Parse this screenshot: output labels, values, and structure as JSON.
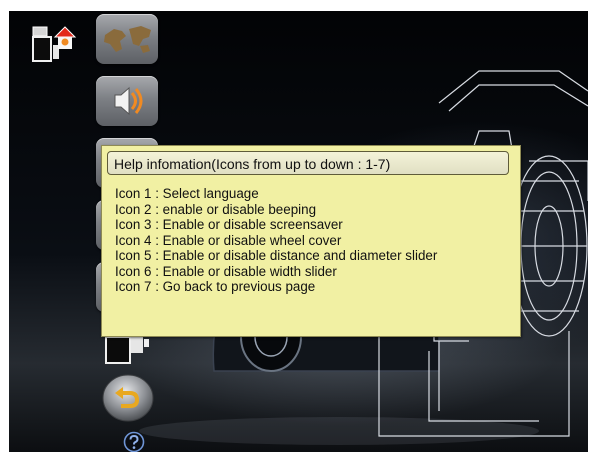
{
  "toolbar": {
    "home_icon": "home-settings-icon",
    "items": [
      {
        "index": 1,
        "icon": "world-map-icon"
      },
      {
        "index": 2,
        "icon": "speaker-icon"
      },
      {
        "index": 3,
        "icon": "screensaver-icon"
      },
      {
        "index": 4,
        "icon": "wheel-cover-icon"
      },
      {
        "index": 5,
        "icon": "distance-diameter-slider-icon"
      },
      {
        "index": 6,
        "icon": "width-slider-icon"
      },
      {
        "index": 7,
        "icon": "back-arrow-icon"
      }
    ],
    "help_icon": "question-mark-icon"
  },
  "help": {
    "title": "Help infomation(Icons from up to down : 1-7)",
    "lines": [
      "Icon 1 : Select language",
      "Icon 2 : enable or disable beeping",
      "Icon 3 : Enable or disable screensaver",
      "Icon 4 : Enable or disable wheel cover",
      "Icon 5 : Enable or disable distance and diameter slider",
      "Icon 6 : Enable or disable width slider",
      "Icon 7 : Go back to previous page"
    ]
  },
  "colors": {
    "help_background": "#f1f0a3",
    "screen_background": "#05070a",
    "tile_gray": "#7d8085"
  }
}
